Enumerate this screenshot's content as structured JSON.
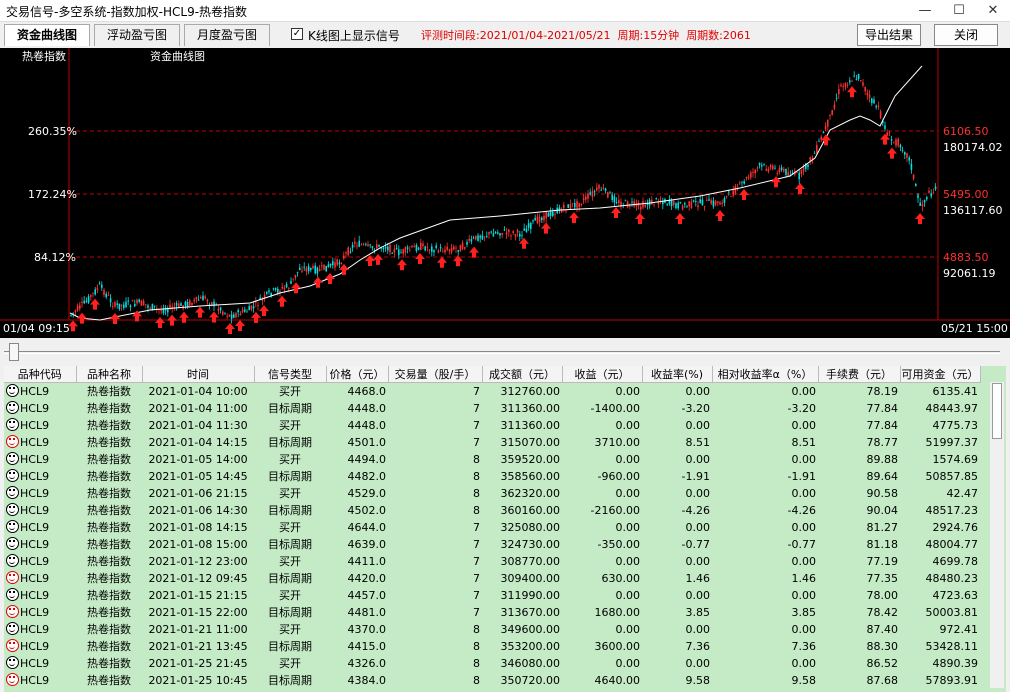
{
  "window": {
    "title": "交易信号-多空系统-指数加权-HCL9-热卷指数",
    "minimize": "—",
    "maximize": "☐",
    "close": "✕"
  },
  "toolbar": {
    "tabs": [
      "资金曲线图",
      "浮动盈亏图",
      "月度盈亏图"
    ],
    "active_tab": 0,
    "show_signal_checkbox": true,
    "show_signal_label": "K线图上显示信号",
    "eval_period": "评测时间段:2021/01/04-2021/05/21",
    "cycle": "周期:15分钟",
    "cycle_count": "周期数:2061",
    "export_label": "导出结果",
    "close_label": "关闭"
  },
  "chart": {
    "legend_left": "热卷指数",
    "legend_right": "资金曲线图",
    "left_ticks": [
      "260.35%",
      "172.24%",
      "84.12%"
    ],
    "right_price_ticks": [
      "6106.50",
      "5495.00",
      "4883.50"
    ],
    "right_value_ticks": [
      "180174.02",
      "136117.60",
      "92061.19"
    ],
    "time_start": "01/04 09:15",
    "time_end": "05/21 15:00",
    "colors": {
      "bg": "#000000",
      "up": "#ff3030",
      "down": "#00e0e0",
      "equity": "#ffffff",
      "grid": "#c00000",
      "arrow": "#ff2020"
    }
  },
  "chart_data": {
    "type": "line",
    "title": "资金曲线图",
    "x": [
      "01/04 09:15",
      "05/21 15:00"
    ],
    "series": [
      {
        "name": "热卷指数",
        "price_ticks": [
          4883.5,
          5495.0,
          6106.5
        ]
      },
      {
        "name": "资金曲线图",
        "value_ticks": [
          92061.19,
          136117.6,
          180174.02
        ],
        "pct_ticks": [
          "84.12%",
          "172.24%",
          "260.35%"
        ]
      }
    ]
  },
  "table": {
    "headers": [
      "品种代码",
      "品种名称",
      "时间",
      "信号类型",
      "价格（元）",
      "交易量（股/手）",
      "成交额（元）",
      "收益（元）",
      "收益率(%)",
      "相对收益率α（%）",
      "手续费（元）",
      "可用资金（元）"
    ],
    "rows": [
      {
        "icon": "dark",
        "code": "HCL9",
        "name": "热卷指数",
        "time": "2021-01-04 10:00",
        "type": "买开",
        "price": "4468.0",
        "qty": "7",
        "amount": "312760.00",
        "profit": "0.00",
        "rate": "0.00",
        "alpha": "0.00",
        "fee": "78.19",
        "cash": "6135.41"
      },
      {
        "icon": "green",
        "code": "HCL9",
        "name": "热卷指数",
        "time": "2021-01-04 11:00",
        "type": "目标周期",
        "price": "4448.0",
        "qty": "7",
        "amount": "311360.00",
        "profit": "-1400.00",
        "rate": "-3.20",
        "alpha": "-3.20",
        "fee": "77.84",
        "cash": "48443.97"
      },
      {
        "icon": "dark",
        "code": "HCL9",
        "name": "热卷指数",
        "time": "2021-01-04 11:30",
        "type": "买开",
        "price": "4448.0",
        "qty": "7",
        "amount": "311360.00",
        "profit": "0.00",
        "rate": "0.00",
        "alpha": "0.00",
        "fee": "77.84",
        "cash": "4775.73"
      },
      {
        "icon": "red",
        "code": "HCL9",
        "name": "热卷指数",
        "time": "2021-01-04 14:15",
        "type": "目标周期",
        "price": "4501.0",
        "qty": "7",
        "amount": "315070.00",
        "profit": "3710.00",
        "rate": "8.51",
        "alpha": "8.51",
        "fee": "78.77",
        "cash": "51997.37"
      },
      {
        "icon": "dark",
        "code": "HCL9",
        "name": "热卷指数",
        "time": "2021-01-05 14:00",
        "type": "买开",
        "price": "4494.0",
        "qty": "8",
        "amount": "359520.00",
        "profit": "0.00",
        "rate": "0.00",
        "alpha": "0.00",
        "fee": "89.88",
        "cash": "1574.69"
      },
      {
        "icon": "green",
        "code": "HCL9",
        "name": "热卷指数",
        "time": "2021-01-05 14:45",
        "type": "目标周期",
        "price": "4482.0",
        "qty": "8",
        "amount": "358560.00",
        "profit": "-960.00",
        "rate": "-1.91",
        "alpha": "-1.91",
        "fee": "89.64",
        "cash": "50857.85"
      },
      {
        "icon": "dark",
        "code": "HCL9",
        "name": "热卷指数",
        "time": "2021-01-06 21:15",
        "type": "买开",
        "price": "4529.0",
        "qty": "8",
        "amount": "362320.00",
        "profit": "0.00",
        "rate": "0.00",
        "alpha": "0.00",
        "fee": "90.58",
        "cash": "42.47"
      },
      {
        "icon": "green",
        "code": "HCL9",
        "name": "热卷指数",
        "time": "2021-01-06 14:30",
        "type": "目标周期",
        "price": "4502.0",
        "qty": "8",
        "amount": "360160.00",
        "profit": "-2160.00",
        "rate": "-4.26",
        "alpha": "-4.26",
        "fee": "90.04",
        "cash": "48517.23"
      },
      {
        "icon": "dark",
        "code": "HCL9",
        "name": "热卷指数",
        "time": "2021-01-08 14:15",
        "type": "买开",
        "price": "4644.0",
        "qty": "7",
        "amount": "325080.00",
        "profit": "0.00",
        "rate": "0.00",
        "alpha": "0.00",
        "fee": "81.27",
        "cash": "2924.76"
      },
      {
        "icon": "green",
        "code": "HCL9",
        "name": "热卷指数",
        "time": "2021-01-08 15:00",
        "type": "目标周期",
        "price": "4639.0",
        "qty": "7",
        "amount": "324730.00",
        "profit": "-350.00",
        "rate": "-0.77",
        "alpha": "-0.77",
        "fee": "81.18",
        "cash": "48004.77"
      },
      {
        "icon": "dark",
        "code": "HCL9",
        "name": "热卷指数",
        "time": "2021-01-12 23:00",
        "type": "买开",
        "price": "4411.0",
        "qty": "7",
        "amount": "308770.00",
        "profit": "0.00",
        "rate": "0.00",
        "alpha": "0.00",
        "fee": "77.19",
        "cash": "4699.78"
      },
      {
        "icon": "red",
        "code": "HCL9",
        "name": "热卷指数",
        "time": "2021-01-12 09:45",
        "type": "目标周期",
        "price": "4420.0",
        "qty": "7",
        "amount": "309400.00",
        "profit": "630.00",
        "rate": "1.46",
        "alpha": "1.46",
        "fee": "77.35",
        "cash": "48480.23"
      },
      {
        "icon": "dark",
        "code": "HCL9",
        "name": "热卷指数",
        "time": "2021-01-15 21:15",
        "type": "买开",
        "price": "4457.0",
        "qty": "7",
        "amount": "311990.00",
        "profit": "0.00",
        "rate": "0.00",
        "alpha": "0.00",
        "fee": "78.00",
        "cash": "4723.63"
      },
      {
        "icon": "red",
        "code": "HCL9",
        "name": "热卷指数",
        "time": "2021-01-15 22:00",
        "type": "目标周期",
        "price": "4481.0",
        "qty": "7",
        "amount": "313670.00",
        "profit": "1680.00",
        "rate": "3.85",
        "alpha": "3.85",
        "fee": "78.42",
        "cash": "50003.81"
      },
      {
        "icon": "dark",
        "code": "HCL9",
        "name": "热卷指数",
        "time": "2021-01-21 11:00",
        "type": "买开",
        "price": "4370.0",
        "qty": "8",
        "amount": "349600.00",
        "profit": "0.00",
        "rate": "0.00",
        "alpha": "0.00",
        "fee": "87.40",
        "cash": "972.41"
      },
      {
        "icon": "red",
        "code": "HCL9",
        "name": "热卷指数",
        "time": "2021-01-21 13:45",
        "type": "目标周期",
        "price": "4415.0",
        "qty": "8",
        "amount": "353200.00",
        "profit": "3600.00",
        "rate": "7.36",
        "alpha": "7.36",
        "fee": "88.30",
        "cash": "53428.11"
      },
      {
        "icon": "dark",
        "code": "HCL9",
        "name": "热卷指数",
        "time": "2021-01-25 21:45",
        "type": "买开",
        "price": "4326.0",
        "qty": "8",
        "amount": "346080.00",
        "profit": "0.00",
        "rate": "0.00",
        "alpha": "0.00",
        "fee": "86.52",
        "cash": "4890.39"
      },
      {
        "icon": "red",
        "code": "HCL9",
        "name": "热卷指数",
        "time": "2021-01-25 10:45",
        "type": "目标周期",
        "price": "4384.0",
        "qty": "8",
        "amount": "350720.00",
        "profit": "4640.00",
        "rate": "9.58",
        "alpha": "9.58",
        "fee": "87.68",
        "cash": "57893.91"
      }
    ]
  }
}
